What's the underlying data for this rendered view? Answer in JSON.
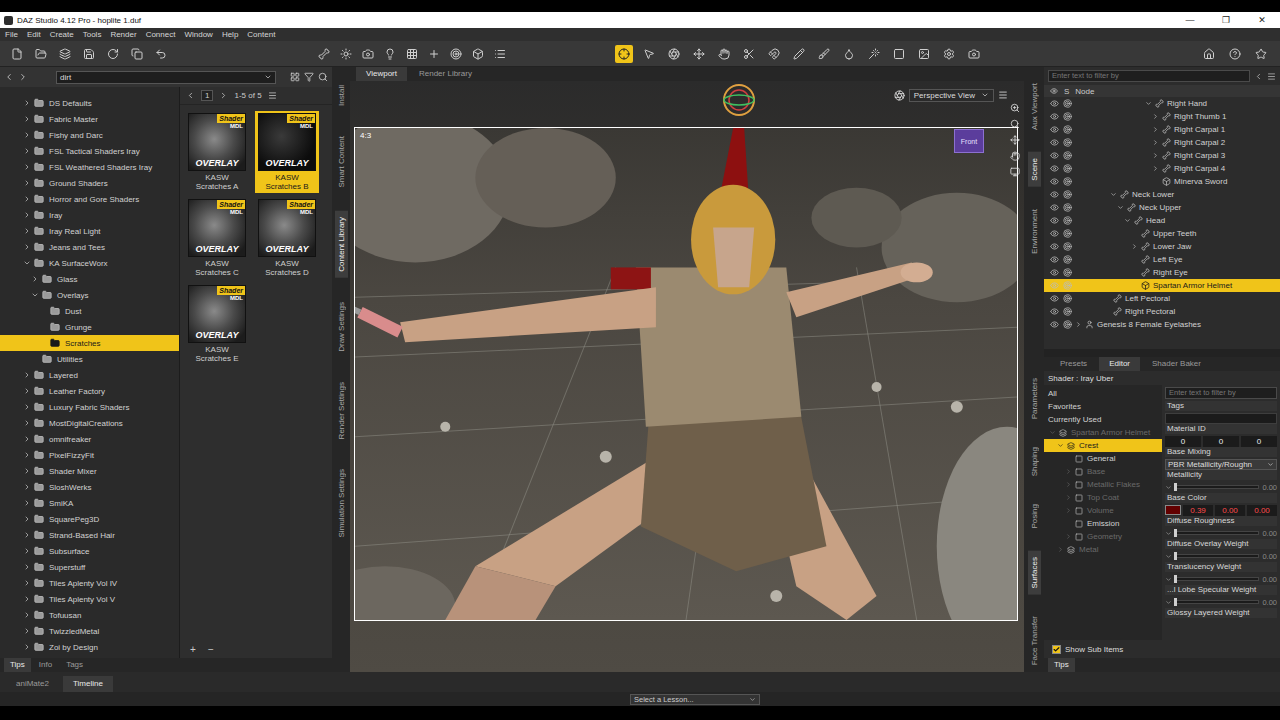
{
  "window": {
    "title": "DAZ Studio 4.12 Pro - hoplite 1.duf",
    "controls": [
      "—",
      "❐",
      "✕"
    ]
  },
  "menu": [
    "File",
    "Edit",
    "Create",
    "Tools",
    "Render",
    "Connect",
    "Window",
    "Help",
    "Content"
  ],
  "toolbar": {
    "tools": [
      {
        "selected": true
      },
      {
        "selected": false
      },
      {
        "selected": false
      },
      {
        "selected": false
      },
      {
        "selected": false
      },
      {
        "selected": false
      },
      {
        "selected": false
      },
      {
        "selected": false
      },
      {
        "selected": false
      },
      {
        "selected": false
      },
      {
        "selected": false
      },
      {
        "selected": false
      },
      {
        "selected": false
      },
      {
        "selected": false
      },
      {
        "selected": false
      }
    ]
  },
  "content_library": {
    "search": "dirt",
    "tree": [
      {
        "label": "DS Defaults",
        "expandable": true,
        "expanded": false,
        "selected": false
      },
      {
        "label": "Fabric Master",
        "expandable": true,
        "expanded": false,
        "selected": false
      },
      {
        "label": "Fishy and Darc",
        "expandable": true,
        "expanded": false,
        "selected": false
      },
      {
        "label": "FSL Tactical Shaders Iray",
        "expandable": true,
        "expanded": false,
        "selected": false
      },
      {
        "label": "FSL Weathered Shaders Iray",
        "expandable": true,
        "expanded": false,
        "selected": false
      },
      {
        "label": "Ground Shaders",
        "expandable": true,
        "expanded": false,
        "selected": false
      },
      {
        "label": "Horror and Gore Shaders",
        "expandable": true,
        "expanded": false,
        "selected": false
      },
      {
        "label": "Iray",
        "expandable": true,
        "expanded": false,
        "selected": false
      },
      {
        "label": "Iray Real Light",
        "expandable": true,
        "expanded": false,
        "selected": false
      },
      {
        "label": "Jeans and Tees",
        "expandable": true,
        "expanded": false,
        "selected": false
      },
      {
        "label": "KA SurfaceWorx",
        "expandable": true,
        "expanded": true,
        "selected": false,
        "children": [
          {
            "label": "Glass",
            "expandable": true,
            "expanded": false,
            "selected": false
          },
          {
            "label": "Overlays",
            "expandable": true,
            "expanded": true,
            "selected": false,
            "children": [
              {
                "label": "Dust",
                "expandable": false,
                "expanded": false,
                "selected": false
              },
              {
                "label": "Grunge",
                "expandable": false,
                "expanded": false,
                "selected": false
              },
              {
                "label": "Scratches",
                "expandable": false,
                "expanded": false,
                "selected": true
              }
            ]
          },
          {
            "label": "Utilities",
            "expandable": false,
            "expanded": false,
            "selected": false
          }
        ]
      },
      {
        "label": "Layered",
        "expandable": true,
        "expanded": false,
        "selected": false
      },
      {
        "label": "Leather Factory",
        "expandable": true,
        "expanded": false,
        "selected": false
      },
      {
        "label": "Luxury Fabric Shaders",
        "expandable": true,
        "expanded": false,
        "selected": false
      },
      {
        "label": "MostDigitalCreations",
        "expandable": true,
        "expanded": false,
        "selected": false
      },
      {
        "label": "omnifreaker",
        "expandable": true,
        "expanded": false,
        "selected": false
      },
      {
        "label": "PixelFizzyFit",
        "expandable": true,
        "expanded": false,
        "selected": false
      },
      {
        "label": "Shader Mixer",
        "expandable": true,
        "expanded": false,
        "selected": false
      },
      {
        "label": "SloshWerks",
        "expandable": true,
        "expanded": false,
        "selected": false
      },
      {
        "label": "SmiKA",
        "expandable": true,
        "expanded": false,
        "selected": false
      },
      {
        "label": "SquarePeg3D",
        "expandable": true,
        "expanded": false,
        "selected": false
      },
      {
        "label": "Strand-Based Hair",
        "expandable": true,
        "expanded": false,
        "selected": false
      },
      {
        "label": "Subsurface",
        "expandable": true,
        "expanded": false,
        "selected": false
      },
      {
        "label": "Superstuff",
        "expandable": true,
        "expanded": false,
        "selected": false
      },
      {
        "label": "Tiles Aplenty Vol IV",
        "expandable": true,
        "expanded": false,
        "selected": false
      },
      {
        "label": "Tiles Aplenty Vol V",
        "expandable": true,
        "expanded": false,
        "selected": false
      },
      {
        "label": "Tofuusan",
        "expandable": true,
        "expanded": false,
        "selected": false
      },
      {
        "label": "TwizzledMetal",
        "expandable": true,
        "expanded": false,
        "selected": false
      },
      {
        "label": "Zoi by Design",
        "expandable": true,
        "expanded": false,
        "selected": false
      }
    ],
    "page": "1",
    "count": "1-5 of 5",
    "badge": {
      "label": "Shader",
      "sub": "MDL"
    },
    "overlay_label": "OVERLAY",
    "items": [
      {
        "name": "KASW Scratches A",
        "selected": false
      },
      {
        "name": "KASW Scratches B",
        "selected": true
      },
      {
        "name": "KASW Scratches C",
        "selected": false
      },
      {
        "name": "KASW Scratches D",
        "selected": false
      },
      {
        "name": "KASW Scratches E",
        "selected": false
      }
    ],
    "footer_buttons": [
      "+",
      "−"
    ],
    "bottom_tabs": [
      {
        "label": "Tips",
        "selected": true
      },
      {
        "label": "Info",
        "selected": false
      },
      {
        "label": "Tags",
        "selected": false
      }
    ]
  },
  "left_side_tabs": [
    {
      "label": "Install",
      "selected": false
    },
    {
      "label": "Smart Content",
      "selected": false
    },
    {
      "label": "Content Library",
      "selected": true
    },
    {
      "label": "Draw Settings",
      "selected": false
    },
    {
      "label": "Render Settings",
      "selected": false
    },
    {
      "label": "Simulation Settings",
      "selected": false
    }
  ],
  "viewport": {
    "tabs": [
      {
        "label": "Viewport",
        "selected": true
      },
      {
        "label": "Render Library",
        "selected": false
      }
    ],
    "camera": "Perspective View",
    "aspect": "4:3",
    "cube_label": "Front"
  },
  "right_side_tabs": {
    "top": [
      {
        "label": "Aux Viewport",
        "selected": false
      },
      {
        "label": "Scene",
        "selected": true
      },
      {
        "label": "Environment",
        "selected": false
      }
    ],
    "bottom": [
      {
        "label": "Parameters",
        "selected": false
      },
      {
        "label": "Shaping",
        "selected": false
      },
      {
        "label": "Posing",
        "selected": false
      },
      {
        "label": "Surfaces",
        "selected": true
      },
      {
        "label": "Face Transfer",
        "selected": false
      }
    ]
  },
  "scene": {
    "filter_placeholder": "Enter text to filter by",
    "columns": [
      "S",
      "Node"
    ],
    "rows": [
      {
        "label": "Right Hand",
        "depth": 10,
        "kind": "bone",
        "expandable": true,
        "expanded": true,
        "selected": false,
        "visible": true
      },
      {
        "label": "Right Thumb 1",
        "depth": 11,
        "kind": "bone",
        "expandable": true,
        "expanded": false,
        "selected": false,
        "visible": true
      },
      {
        "label": "Right Carpal 1",
        "depth": 11,
        "kind": "bone",
        "expandable": true,
        "expanded": false,
        "selected": false,
        "visible": true
      },
      {
        "label": "Right Carpal 2",
        "depth": 11,
        "kind": "bone",
        "expandable": true,
        "expanded": false,
        "selected": false,
        "visible": true
      },
      {
        "label": "Right Carpal 3",
        "depth": 11,
        "kind": "bone",
        "expandable": true,
        "expanded": false,
        "selected": false,
        "visible": true
      },
      {
        "label": "Right Carpal 4",
        "depth": 11,
        "kind": "bone",
        "expandable": true,
        "expanded": false,
        "selected": false,
        "visible": true
      },
      {
        "label": "Minerva Sword",
        "depth": 11,
        "kind": "prop",
        "expandable": false,
        "expanded": false,
        "selected": false,
        "visible": true
      },
      {
        "label": "Neck Lower",
        "depth": 5,
        "kind": "bone",
        "expandable": true,
        "expanded": true,
        "selected": false,
        "visible": true
      },
      {
        "label": "Neck Upper",
        "depth": 6,
        "kind": "bone",
        "expandable": true,
        "expanded": true,
        "selected": false,
        "visible": true
      },
      {
        "label": "Head",
        "depth": 7,
        "kind": "bone",
        "expandable": true,
        "expanded": true,
        "selected": false,
        "visible": true
      },
      {
        "label": "Upper Teeth",
        "depth": 8,
        "kind": "bone",
        "expandable": false,
        "expanded": false,
        "selected": false,
        "visible": true
      },
      {
        "label": "Lower Jaw",
        "depth": 8,
        "kind": "bone",
        "expandable": true,
        "expanded": false,
        "selected": false,
        "visible": true
      },
      {
        "label": "Left Eye",
        "depth": 8,
        "kind": "bone",
        "expandable": false,
        "expanded": false,
        "selected": false,
        "visible": true
      },
      {
        "label": "Right Eye",
        "depth": 8,
        "kind": "bone",
        "expandable": false,
        "expanded": false,
        "selected": false,
        "visible": true
      },
      {
        "label": "Spartan Armor Helmet",
        "depth": 8,
        "kind": "prop",
        "expandable": false,
        "expanded": false,
        "selected": true,
        "visible": true
      },
      {
        "label": "Left Pectoral",
        "depth": 4,
        "kind": "bone",
        "expandable": false,
        "expanded": false,
        "selected": false,
        "visible": true
      },
      {
        "label": "Right Pectoral",
        "depth": 4,
        "kind": "bone",
        "expandable": false,
        "expanded": false,
        "selected": false,
        "visible": true
      },
      {
        "label": "Genesis 8 Female Eyelashes",
        "depth": 0,
        "kind": "figure",
        "expandable": true,
        "expanded": false,
        "selected": false,
        "visible": true
      }
    ]
  },
  "surfaces": {
    "tabs": [
      {
        "label": "Presets",
        "selected": false
      },
      {
        "label": "Editor",
        "selected": true
      },
      {
        "label": "Shader Baker",
        "selected": false
      }
    ],
    "shader": "Shader : Iray Uber",
    "filter_placeholder": "Enter text to filter by",
    "list": [
      {
        "label": "All",
        "kind": "filter",
        "depth": 0,
        "expandable": false,
        "expanded": false,
        "disabled": false,
        "selected": false
      },
      {
        "label": "Favorites",
        "kind": "filter",
        "depth": 0,
        "expandable": false,
        "expanded": false,
        "disabled": false,
        "selected": false
      },
      {
        "label": "Currently Used",
        "kind": "filter",
        "depth": 0,
        "expandable": false,
        "expanded": false,
        "disabled": false,
        "selected": false
      },
      {
        "label": "Spartan Armor Helmet",
        "kind": "object",
        "depth": 0,
        "expandable": true,
        "expanded": true,
        "disabled": true,
        "selected": false
      },
      {
        "label": "Crest",
        "kind": "material",
        "depth": 1,
        "expandable": true,
        "expanded": true,
        "disabled": false,
        "selected": true
      },
      {
        "label": "General",
        "kind": "group",
        "depth": 2,
        "expandable": false,
        "expanded": false,
        "disabled": false,
        "selected": false
      },
      {
        "label": "Base",
        "kind": "group",
        "depth": 2,
        "expandable": true,
        "expanded": false,
        "disabled": true,
        "selected": false
      },
      {
        "label": "Metallic Flakes",
        "kind": "group",
        "depth": 2,
        "expandable": true,
        "expanded": false,
        "disabled": true,
        "selected": false
      },
      {
        "label": "Top Coat",
        "kind": "group",
        "depth": 2,
        "expandable": true,
        "expanded": false,
        "disabled": true,
        "selected": false
      },
      {
        "label": "Volume",
        "kind": "group",
        "depth": 2,
        "expandable": true,
        "expanded": false,
        "disabled": true,
        "selected": false
      },
      {
        "label": "Emission",
        "kind": "group",
        "depth": 2,
        "expandable": false,
        "expanded": false,
        "disabled": false,
        "selected": false
      },
      {
        "label": "Geometry",
        "kind": "group",
        "depth": 2,
        "expandable": true,
        "expanded": false,
        "disabled": true,
        "selected": false
      },
      {
        "label": "Metal",
        "kind": "material",
        "depth": 1,
        "expandable": true,
        "expanded": false,
        "disabled": true,
        "selected": false
      }
    ],
    "properties": [
      {
        "kind": "field",
        "label": "Tags"
      },
      {
        "kind": "numbers",
        "label": "Material ID",
        "values": [
          "0",
          "0",
          "0"
        ]
      },
      {
        "kind": "dropdown",
        "label": "Base Mixing",
        "value": "PBR Metallicity/Roughn"
      },
      {
        "kind": "slider",
        "label": "Metallicity",
        "level": 0,
        "reading": "0.00"
      },
      {
        "kind": "color",
        "label": "Base Color",
        "values": [
          "0.39",
          "0.00",
          "0.00"
        ]
      },
      {
        "kind": "slider",
        "label": "Diffuse Roughness",
        "level": 0,
        "reading": "0.00"
      },
      {
        "kind": "slider",
        "label": "Diffuse Overlay Weight",
        "level": 0,
        "reading": "0.00"
      },
      {
        "kind": "slider",
        "label": "Translucency Weight",
        "level": 0,
        "reading": "0.00"
      },
      {
        "kind": "slider",
        "label": "...l Lobe Specular Weight",
        "level": 0,
        "reading": "0.00"
      },
      {
        "kind": "label",
        "label": "Glossy Layered Weight"
      }
    ],
    "show_sub_items": {
      "label": "Show Sub Items",
      "checked": true
    },
    "bottom_tab": "Tips"
  },
  "bottom_tabs": [
    {
      "label": "aniMate2",
      "selected": false
    },
    {
      "label": "Timeline",
      "selected": true
    }
  ],
  "status": {
    "lesson": "Select a Lesson..."
  }
}
